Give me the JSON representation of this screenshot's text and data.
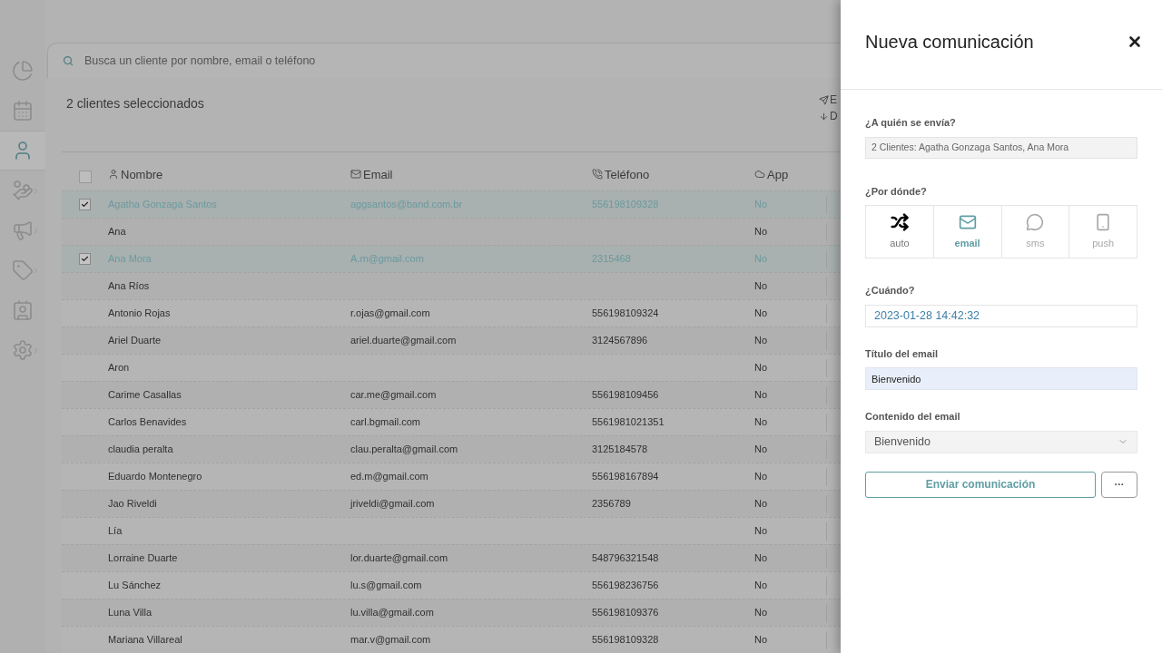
{
  "sidebar": {
    "items": [
      {
        "kind": "chart",
        "selected": false,
        "has_submenu": false
      },
      {
        "kind": "calendar",
        "selected": false,
        "has_submenu": false
      },
      {
        "kind": "user",
        "selected": true,
        "has_submenu": false
      },
      {
        "kind": "coins",
        "selected": false,
        "has_submenu": true
      },
      {
        "kind": "megaphone",
        "selected": false,
        "has_submenu": true
      },
      {
        "kind": "tag",
        "selected": false,
        "has_submenu": true
      },
      {
        "kind": "badge",
        "selected": false,
        "has_submenu": false
      },
      {
        "kind": "settings",
        "selected": false,
        "has_submenu": true
      }
    ]
  },
  "search": {
    "placeholder": "Busca un cliente por nombre, email o teléfono"
  },
  "selection_summary": "2 clientes seleccionados",
  "actions": [
    {
      "kind": "send",
      "label": "E"
    },
    {
      "kind": "download",
      "label": "D"
    }
  ],
  "table": {
    "columns": [
      {
        "kind": "user",
        "label": "Nombre"
      },
      {
        "kind": "mail",
        "label": "Email"
      },
      {
        "kind": "phone",
        "label": "Teléfono"
      },
      {
        "kind": "cloud",
        "label": "App"
      }
    ],
    "all_checked": false,
    "rows": [
      {
        "name": "Agatha Gonzaga Santos",
        "email": "aggsantos@band.com.br",
        "phone": "556198109328",
        "app": "No",
        "selected": true
      },
      {
        "name": "Ana",
        "email": "",
        "phone": "",
        "app": "No",
        "selected": false
      },
      {
        "name": "Ana Mora",
        "email": "A.m@gmail.com",
        "phone": "2315468",
        "app": "No",
        "selected": true
      },
      {
        "name": "Ana Ríos",
        "email": "",
        "phone": "",
        "app": "No",
        "selected": false
      },
      {
        "name": "Antonio Rojas",
        "email": "r.ojas@gmail.com",
        "phone": "556198109324",
        "app": "No",
        "selected": false
      },
      {
        "name": "Ariel Duarte",
        "email": "ariel.duarte@gmail.com",
        "phone": "3124567896",
        "app": "No",
        "selected": false
      },
      {
        "name": "Aron",
        "email": "",
        "phone": "",
        "app": "No",
        "selected": false
      },
      {
        "name": "Carime Casallas",
        "email": "car.me@gmail.com",
        "phone": "556198109456",
        "app": "No",
        "selected": false
      },
      {
        "name": "Carlos Benavides",
        "email": "carl.bgmail.com",
        "phone": "5561981021351",
        "app": "No",
        "selected": false
      },
      {
        "name": "claudia peralta",
        "email": "clau.peralta@gmail.com",
        "phone": "3125184578",
        "app": "No",
        "selected": false
      },
      {
        "name": "Eduardo Montenegro",
        "email": "ed.m@gmail.com",
        "phone": "556198167894",
        "app": "No",
        "selected": false
      },
      {
        "name": "Jao Riveldi",
        "email": "jriveldi@gmail.com",
        "phone": "2356789",
        "app": "No",
        "selected": false
      },
      {
        "name": "Lía",
        "email": "",
        "phone": "",
        "app": "No",
        "selected": false
      },
      {
        "name": "Lorraine Duarte",
        "email": "lor.duarte@gmail.com",
        "phone": "548796321548",
        "app": "No",
        "selected": false
      },
      {
        "name": "Lu Sánchez",
        "email": "lu.s@gmail.com",
        "phone": "556198236756",
        "app": "No",
        "selected": false
      },
      {
        "name": "Luna Villa",
        "email": "lu.villa@gmail.com",
        "phone": "556198109376",
        "app": "No",
        "selected": false
      },
      {
        "name": "Mariana Villareal",
        "email": "mar.v@gmail.com",
        "phone": "556198109328",
        "app": "No",
        "selected": false
      }
    ]
  },
  "drawer": {
    "title": "Nueva comunicación",
    "recipients": {
      "label": "¿A quién se envía?",
      "value": "2 Clientes: Agatha Gonzaga Santos, Ana Mora"
    },
    "channel": {
      "label": "¿Por dónde?",
      "options": [
        {
          "kind": "auto",
          "label": "auto",
          "selected": false,
          "disabled": false
        },
        {
          "kind": "email",
          "label": "email",
          "selected": true,
          "disabled": false
        },
        {
          "kind": "sms",
          "label": "sms",
          "selected": false,
          "disabled": true
        },
        {
          "kind": "push",
          "label": "push",
          "selected": false,
          "disabled": true
        }
      ]
    },
    "when": {
      "label": "¿Cuándo?",
      "value": "2023-01-28 14:42:32"
    },
    "subject": {
      "label": "Título del email",
      "value": "Bienvenido"
    },
    "content": {
      "label": "Contenido del email",
      "value": "Bienvenido"
    },
    "submit": "Enviar comunicación",
    "more": "···"
  }
}
